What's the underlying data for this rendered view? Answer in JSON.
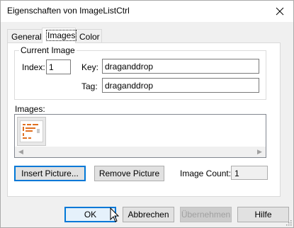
{
  "window": {
    "title": "Eigenschaften von ImageListCtrl"
  },
  "tabs": [
    {
      "label": "General"
    },
    {
      "label": "Images"
    },
    {
      "label": "Color"
    }
  ],
  "current_image": {
    "group_label": "Current Image",
    "index_label": "Index:",
    "index_value": "1",
    "key_label": "Key:",
    "key_value": "draganddrop",
    "tag_label": "Tag:",
    "tag_value": "draganddrop"
  },
  "images": {
    "label": "Images:"
  },
  "actions": {
    "insert_picture": "Insert Picture...",
    "remove_picture": "Remove Picture",
    "image_count_label": "Image Count:",
    "image_count_value": "1"
  },
  "footer": {
    "ok": "OK",
    "cancel": "Abbrechen",
    "apply": "Übernehmen",
    "help": "Hilfe"
  }
}
